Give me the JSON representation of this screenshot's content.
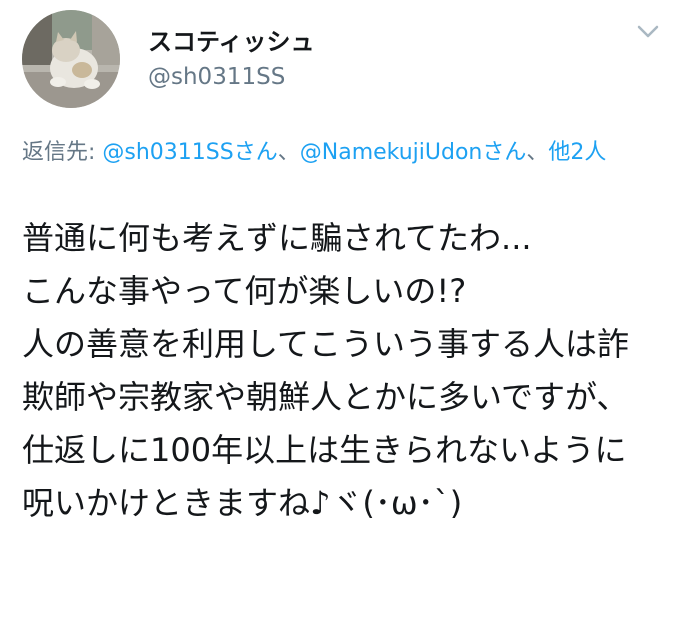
{
  "user": {
    "display_name": "スコティッシュ",
    "handle": "@sh0311SS"
  },
  "reply": {
    "prefix": "返信先: ",
    "mention1": "@sh0311SSさん",
    "sep1": "、",
    "mention2": "@NamekujiUdonさん",
    "sep2": "、",
    "others": "他2人"
  },
  "tweet": {
    "text": "普通に何も考えずに騙されてたわ...\nこんな事やって何が楽しいの!?\n人の善意を利用してこういう事する人は詐欺師や宗教家や朝鮮人とかに多いですが、仕返しに100年以上は生きられないように呪いかけときますね♪ヾ(･ω･`)"
  },
  "icons": {
    "avatar": "cat-photo-avatar",
    "menu": "chevron-down-icon"
  },
  "colors": {
    "text": "#14171a",
    "secondary": "#657786",
    "link": "#1da1f2"
  }
}
